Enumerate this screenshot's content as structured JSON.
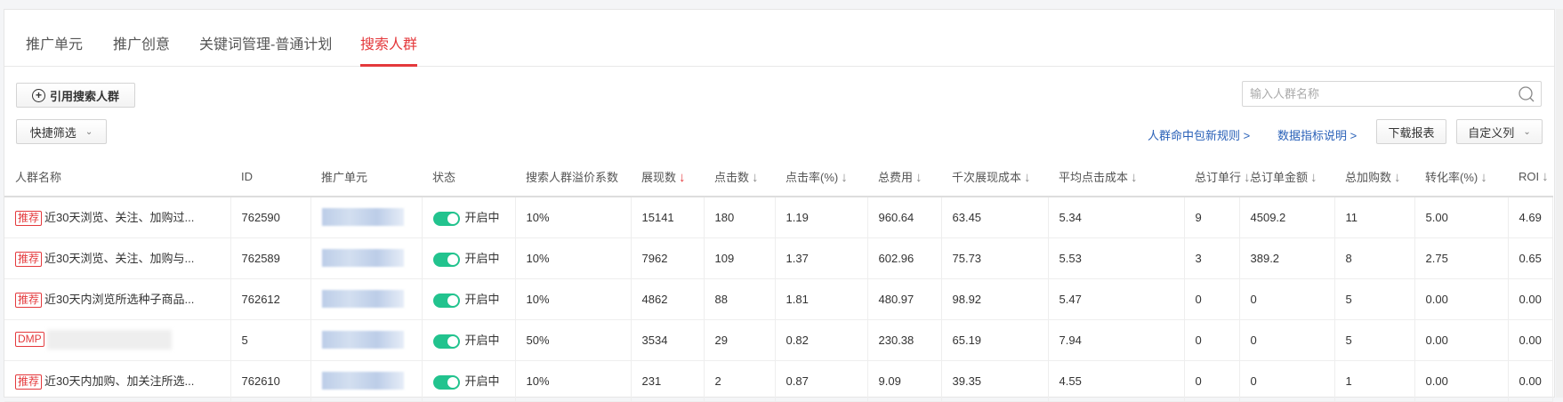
{
  "tabs": [
    "推广单元",
    "推广创意",
    "关键词管理-普通计划",
    "搜索人群"
  ],
  "toolbar": {
    "add_label": "引用搜索人群",
    "filter_label": "快捷筛选",
    "search_placeholder": "输入人群名称",
    "link_rules": "人群命中包新规则 >",
    "link_metrics": "数据指标说明 >",
    "download_label": "下载报表",
    "custom_cols_label": "自定义列"
  },
  "columns": [
    "人群名称",
    "ID",
    "推广单元",
    "状态",
    "搜索人群溢价系数",
    "展现数",
    "点击数",
    "点击率(%)",
    "总费用",
    "千次展现成本",
    "平均点击成本",
    "总订单行",
    "总订单金额",
    "总加购数",
    "转化率(%)",
    "ROI"
  ],
  "rows": [
    {
      "tag": "推荐",
      "name": "近30天浏览、关注、加购过...",
      "id": "762590",
      "status": "开启中",
      "premium": "10%",
      "impressions": "15141",
      "clicks": "180",
      "ctr": "1.19",
      "cost": "960.64",
      "cpm": "63.45",
      "cpc": "5.34",
      "orders": "9",
      "order_amount": "4509.2",
      "carts": "11",
      "cvr": "5.00",
      "roi": "4.69"
    },
    {
      "tag": "推荐",
      "name": "近30天浏览、关注、加购与...",
      "id": "762589",
      "status": "开启中",
      "premium": "10%",
      "impressions": "7962",
      "clicks": "109",
      "ctr": "1.37",
      "cost": "602.96",
      "cpm": "75.73",
      "cpc": "5.53",
      "orders": "3",
      "order_amount": "389.2",
      "carts": "8",
      "cvr": "2.75",
      "roi": "0.65"
    },
    {
      "tag": "推荐",
      "name": "近30天内浏览所选种子商品...",
      "id": "762612",
      "status": "开启中",
      "premium": "10%",
      "impressions": "4862",
      "clicks": "88",
      "ctr": "1.81",
      "cost": "480.97",
      "cpm": "98.92",
      "cpc": "5.47",
      "orders": "0",
      "order_amount": "0",
      "carts": "5",
      "cvr": "0.00",
      "roi": "0.00"
    },
    {
      "tag": "DMP",
      "name": "",
      "id": "5",
      "status": "开启中",
      "premium": "50%",
      "impressions": "3534",
      "clicks": "29",
      "ctr": "0.82",
      "cost": "230.38",
      "cpm": "65.19",
      "cpc": "7.94",
      "orders": "0",
      "order_amount": "0",
      "carts": "5",
      "cvr": "0.00",
      "roi": "0.00"
    },
    {
      "tag": "推荐",
      "name": "近30天内加购、加关注所选...",
      "id": "762610",
      "status": "开启中",
      "premium": "10%",
      "impressions": "231",
      "clicks": "2",
      "ctr": "0.87",
      "cost": "9.09",
      "cpm": "39.35",
      "cpc": "4.55",
      "orders": "0",
      "order_amount": "0",
      "carts": "1",
      "cvr": "0.00",
      "roi": "0.00"
    }
  ]
}
